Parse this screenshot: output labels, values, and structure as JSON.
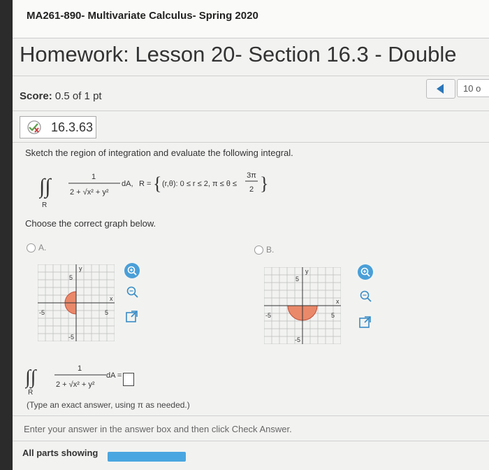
{
  "course": {
    "title": "MA261-890- Multivariate Calculus- Spring 2020"
  },
  "homework": {
    "title": "Homework: Lesson 20- Section 16.3 - Double"
  },
  "score": {
    "label": "Score:",
    "value": "0.5 of 1 pt"
  },
  "nav": {
    "question_count": "10 o"
  },
  "question": {
    "id": "16.3.63",
    "prompt": "Sketch the region of integration and evaluate the following integral.",
    "integrand_num": "1",
    "region_sub": "R",
    "dA": "dA,",
    "region_def": "R =",
    "region_set": "(r,θ): 0 ≤ r ≤ 2, π ≤ θ ≤",
    "angle_num": "3π",
    "angle_den": "2",
    "choose": "Choose the correct graph below.",
    "option_a": "A.",
    "option_b": "B.",
    "answer_dA": "dA =",
    "hint": "(Type an exact answer, using π as needed.)",
    "plus_sqrt": "2 + √x² + y²"
  },
  "graph": {
    "y_label": "y",
    "x_label": "x",
    "tick_5": "5",
    "tick_neg5": "-5"
  },
  "footer": {
    "enter_answer": "Enter your answer in the answer box and then click Check Answer.",
    "all_parts": "All parts showing",
    "progress_fraction": 1.0
  },
  "colors": {
    "region_fill": "#e9896a",
    "accent": "#4a9fd8"
  }
}
